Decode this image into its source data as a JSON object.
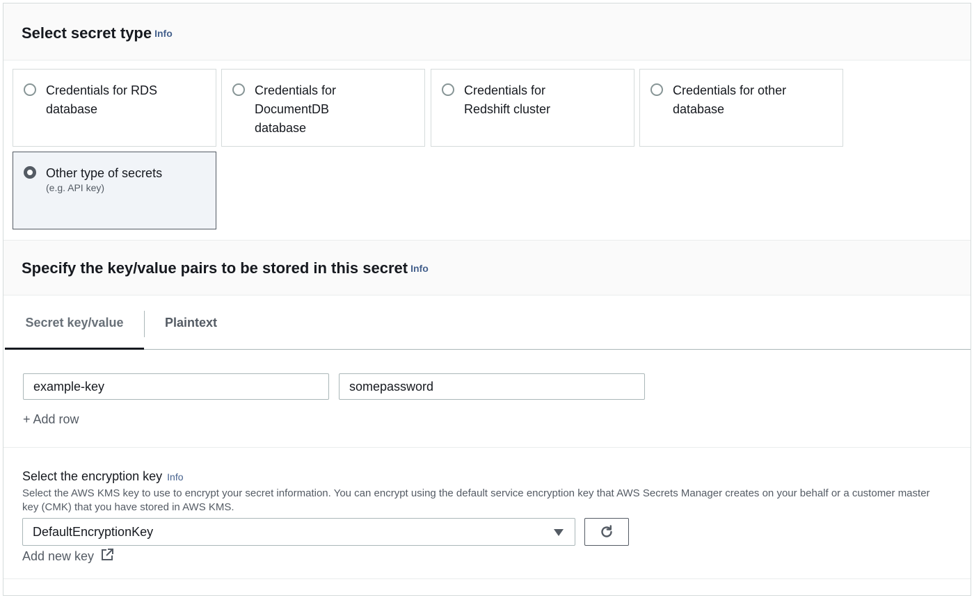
{
  "section1": {
    "title": "Select secret type",
    "info": "Info",
    "options": [
      {
        "label": "Credentials for RDS database",
        "sub": "",
        "selected": false
      },
      {
        "label": "Credentials for DocumentDB database",
        "sub": "",
        "selected": false
      },
      {
        "label": "Credentials for Redshift cluster",
        "sub": "",
        "selected": false
      },
      {
        "label": "Credentials for other database",
        "sub": "",
        "selected": false
      },
      {
        "label": "Other type of secrets",
        "sub": "(e.g. API key)",
        "selected": true
      }
    ]
  },
  "section2": {
    "title": "Specify the key/value pairs to be stored in this secret",
    "info": "Info",
    "tabs": [
      {
        "label": "Secret key/value",
        "active": true
      },
      {
        "label": "Plaintext",
        "active": false
      }
    ],
    "rows": [
      {
        "key": "example-key",
        "value": "somepassword"
      }
    ],
    "add_row": "+ Add row"
  },
  "encryption": {
    "title": "Select the encryption key",
    "info": "Info",
    "description": "Select the AWS KMS key to use to encrypt your secret information. You can encrypt using the default service encryption key that AWS Secrets Manager creates on your behalf or a customer master key (CMK) that you have stored in AWS KMS.",
    "selected_key": "DefaultEncryptionKey",
    "add_new_key": "Add new key",
    "refresh_icon": "refresh-icon",
    "external_icon": "external-link-icon"
  }
}
